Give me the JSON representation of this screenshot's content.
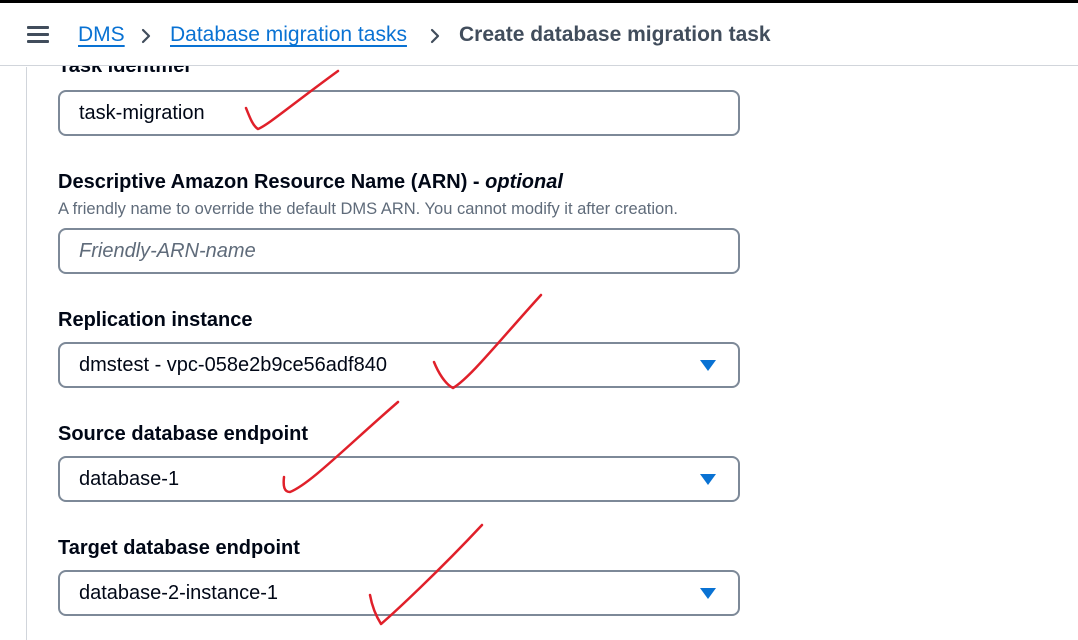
{
  "header": {
    "breadcrumbs": [
      {
        "label": "DMS"
      },
      {
        "label": "Database migration tasks"
      },
      {
        "label": "Create database migration task"
      }
    ]
  },
  "form": {
    "task_identifier": {
      "label": "Task identifier",
      "value": "task-migration"
    },
    "arn": {
      "label": "Descriptive Amazon Resource Name (ARN) - ",
      "optional": "optional",
      "description": "A friendly name to override the default DMS ARN. You cannot modify it after creation.",
      "placeholder": "Friendly-ARN-name"
    },
    "replication_instance": {
      "label": "Replication instance",
      "value": "dmstest - vpc-058e2b9ce56adf840"
    },
    "source_endpoint": {
      "label": "Source database endpoint",
      "value": "database-1"
    },
    "target_endpoint": {
      "label": "Target database endpoint",
      "value": "database-2-instance-1"
    }
  },
  "colors": {
    "link": "#0972d3",
    "caret": "#0972d3",
    "annotation": "#e0202a"
  }
}
